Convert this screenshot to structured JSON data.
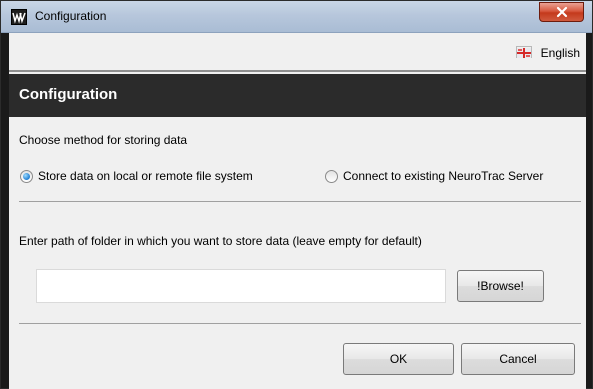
{
  "window": {
    "title": "Configuration",
    "close_symbol": "×"
  },
  "language": {
    "label": "English",
    "flag_icon": "flag-uk-icon"
  },
  "header": {
    "title": "Configuration"
  },
  "storage": {
    "section_label": "Choose method for storing data",
    "options": [
      {
        "label": "Store data on local or remote file system",
        "checked": true
      },
      {
        "label": "Connect to existing NeuroTrac Server",
        "checked": false
      }
    ]
  },
  "path": {
    "label": "Enter path of folder in which you want to store data (leave empty for default)",
    "value": "",
    "placeholder": "",
    "browse_label": "!Browse!"
  },
  "footer": {
    "ok_label": "OK",
    "cancel_label": "Cancel"
  },
  "colors": {
    "header_bg": "#2b2b2b",
    "radio_accent": "#1f7dd1",
    "close_red": "#c4391c"
  }
}
